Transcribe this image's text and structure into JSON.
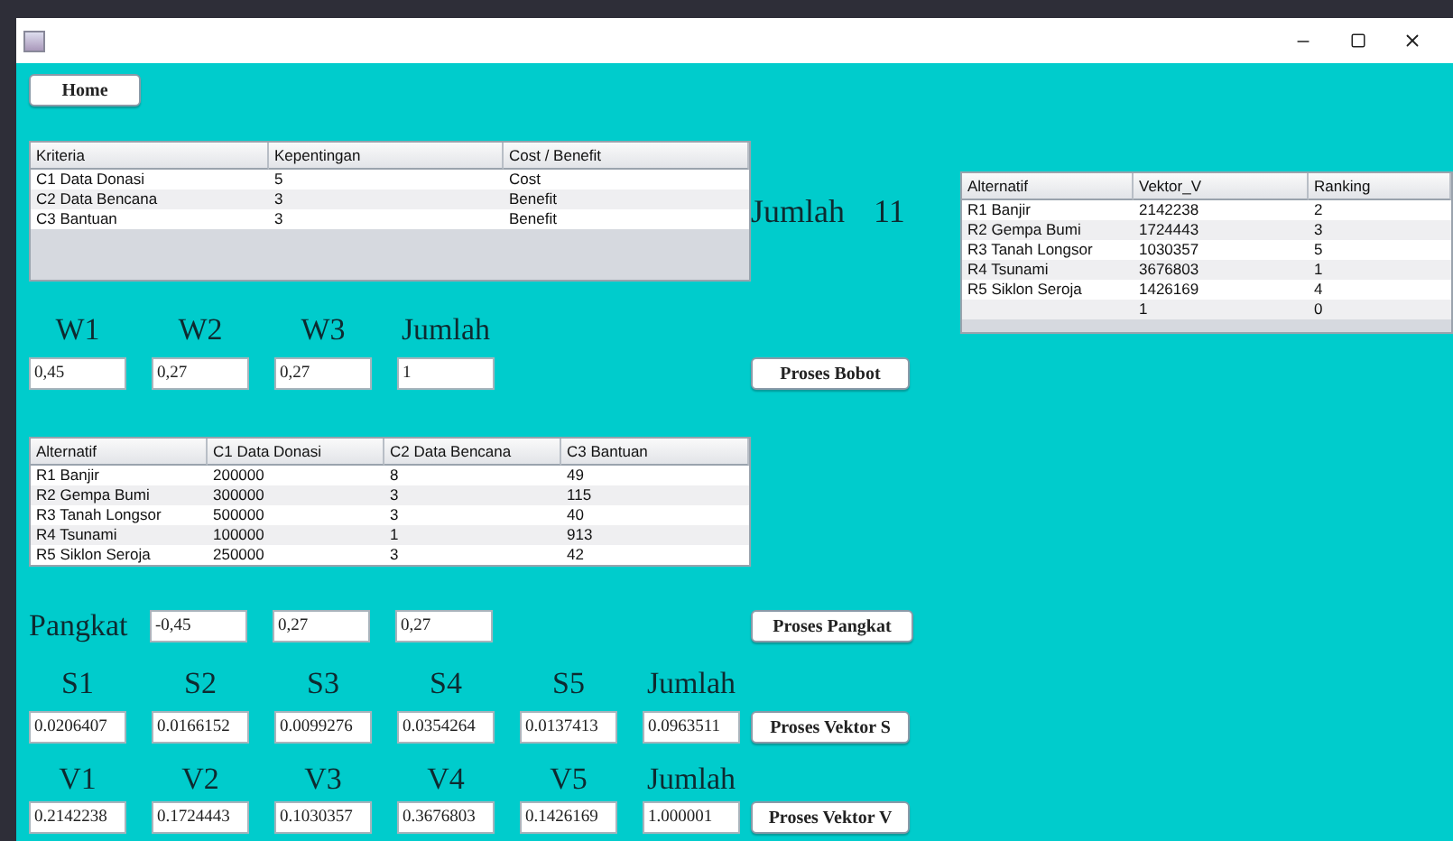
{
  "home_button": "Home",
  "criteria_table": {
    "columns": [
      "Kriteria",
      "Kepentingan",
      "Cost / Benefit"
    ],
    "rows": [
      [
        "C1 Data Donasi",
        "5",
        "Cost"
      ],
      [
        "C2 Data Bencana",
        "3",
        "Benefit"
      ],
      [
        "C3 Bantuan",
        "3",
        "Benefit"
      ]
    ]
  },
  "total_importance": {
    "label": "Jumlah",
    "value": "11"
  },
  "weights": {
    "labels": [
      "W1",
      "W2",
      "W3",
      "Jumlah"
    ],
    "values": [
      "0,45",
      "0,27",
      "0,27",
      "1"
    ]
  },
  "proses_bobot_button": "Proses Bobot",
  "alternatives_table": {
    "columns": [
      "Alternatif",
      "C1 Data Donasi",
      "C2 Data Bencana",
      "C3 Bantuan"
    ],
    "rows": [
      [
        "R1 Banjir",
        "200000",
        "8",
        "49"
      ],
      [
        "R2 Gempa Bumi",
        "300000",
        "3",
        "115"
      ],
      [
        "R3 Tanah Longsor",
        "500000",
        "3",
        "40"
      ],
      [
        "R4 Tsunami",
        "100000",
        "1",
        "913"
      ],
      [
        "R5 Siklon Seroja",
        "250000",
        "3",
        "42"
      ]
    ]
  },
  "exponents": {
    "label": "Pangkat",
    "values": [
      "-0,45",
      "0,27",
      "0,27"
    ]
  },
  "proses_pangkat_button": "Proses Pangkat",
  "vector_s": {
    "labels": [
      "S1",
      "S2",
      "S3",
      "S4",
      "S5",
      "Jumlah"
    ],
    "values": [
      "0.0206407",
      "0.0166152",
      "0.0099276",
      "0.0354264",
      "0.0137413",
      "0.0963511"
    ]
  },
  "proses_vektor_s_button": "Proses Vektor S",
  "vector_v": {
    "labels": [
      "V1",
      "V2",
      "V3",
      "V4",
      "V5",
      "Jumlah"
    ],
    "values": [
      "0.2142238",
      "0.1724443",
      "0.1030357",
      "0.3676803",
      "0.1426169",
      "1.000001"
    ]
  },
  "proses_vektor_v_button": "Proses Vektor V",
  "ranking_table": {
    "columns": [
      "Alternatif",
      "Vektor_V",
      "Ranking"
    ],
    "rows": [
      [
        "R1 Banjir",
        "2142238",
        "2"
      ],
      [
        "R2 Gempa Bumi",
        "1724443",
        "3"
      ],
      [
        "R3 Tanah Longsor",
        "1030357",
        "5"
      ],
      [
        "R4 Tsunami",
        "3676803",
        "1"
      ],
      [
        "R5 Siklon Seroja",
        "1426169",
        "4"
      ],
      [
        "",
        "1",
        "0"
      ]
    ]
  }
}
